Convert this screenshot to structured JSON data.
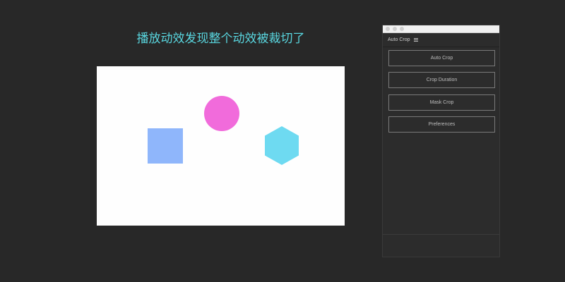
{
  "caption": "播放动效发现整个动效被裁切了",
  "stage": {
    "background": "#fefefe",
    "shapes": [
      {
        "name": "square",
        "color": "#8fb6fb"
      },
      {
        "name": "circle",
        "color": "#f16bdb"
      },
      {
        "name": "hexagon",
        "color": "#6edaf1"
      }
    ]
  },
  "panel": {
    "title": "Auto Crop",
    "menu_icon": "hamburger-menu-icon",
    "buttons": [
      {
        "label": "Auto Crop"
      },
      {
        "label": "Crop Duration"
      },
      {
        "label": "Mask Crop"
      },
      {
        "label": "Preferences"
      }
    ]
  },
  "colors": {
    "caption": "#59d6df",
    "background": "#282828",
    "panel": "#2c2c2c"
  }
}
